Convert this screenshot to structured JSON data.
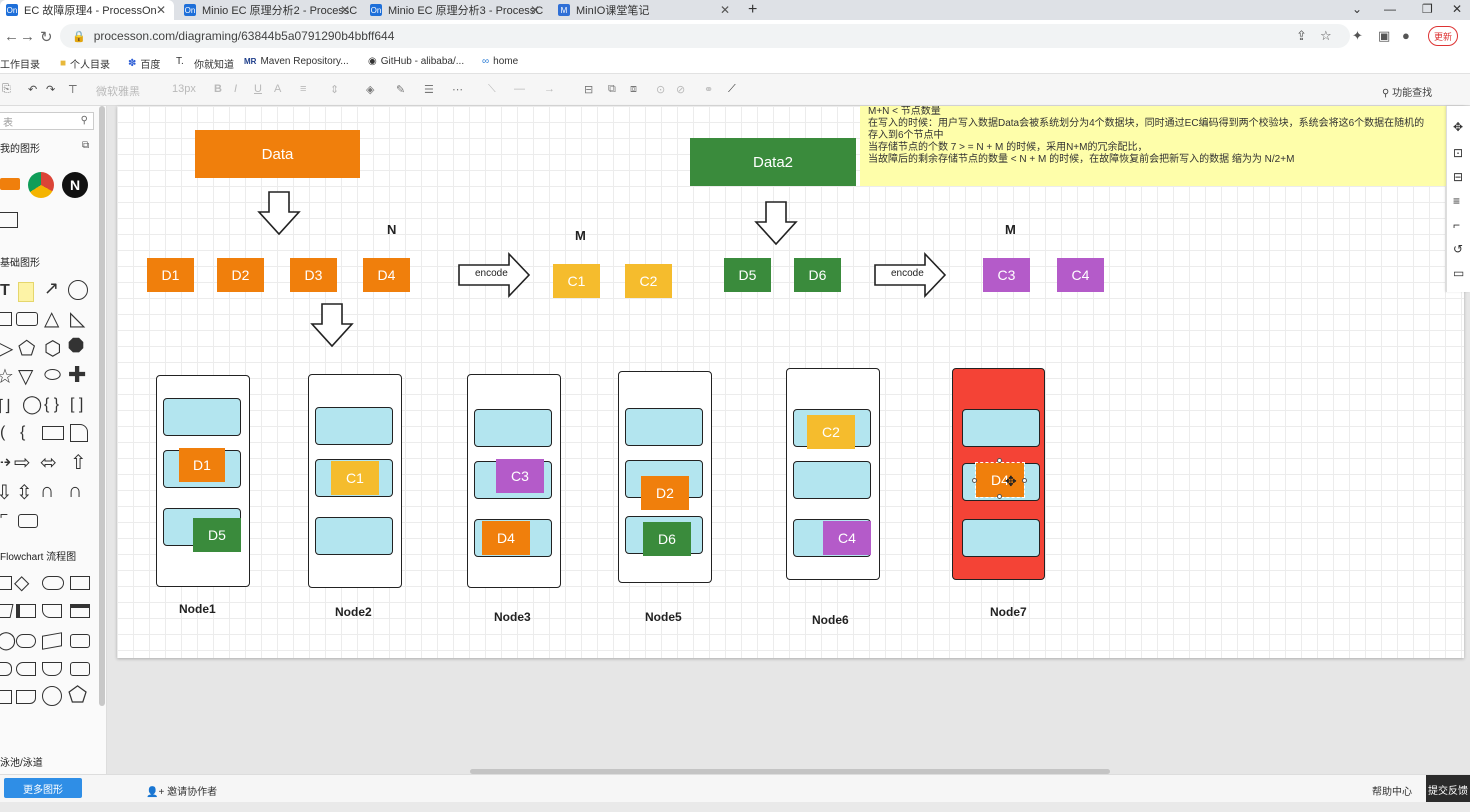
{
  "browser": {
    "tabs": [
      {
        "favicon": "On",
        "title": "EC 故障原理4 - ProcessOn",
        "active": true
      },
      {
        "favicon": "On",
        "title": "Minio EC 原理分析2 - ProcessC",
        "active": false
      },
      {
        "favicon": "On",
        "title": "Minio EC 原理分析3 - ProcessC",
        "active": false
      },
      {
        "favicon": "M",
        "title": "MinIO课堂笔记",
        "active": false
      }
    ],
    "new_tab": "+",
    "address": "processon.com/diagraming/63844b5a0791290b4bbff644",
    "update_label": "更新",
    "bookmarks": [
      {
        "icon": "folder-icon",
        "label": "工作目录"
      },
      {
        "icon": "folder-icon",
        "label": "个人目录"
      },
      {
        "icon": "paw-icon",
        "label": "百度"
      },
      {
        "icon": "",
        "label": "T."
      },
      {
        "icon": "",
        "label": "你就知道"
      },
      {
        "icon": "maven-icon",
        "label": "Maven Repository..."
      },
      {
        "icon": "github-icon",
        "label": "GitHub - alibaba/..."
      },
      {
        "icon": "link-icon",
        "label": "home"
      }
    ]
  },
  "toolbar": {
    "font_family": "微软雅黑",
    "font_size": "13px",
    "shortcuts_label": "功能查找"
  },
  "left_panel": {
    "search_placeholder": "表",
    "sections": [
      "我的图形",
      "基础图形",
      "Flowchart 流程图",
      "泳池/泳道"
    ],
    "more_shapes": "更多图形"
  },
  "statusbar": {
    "invite": "邀请协作者",
    "help": "帮助中心",
    "feedback": "提交反馈"
  },
  "canvas": {
    "data_blocks": [
      {
        "label": "Data",
        "color": "#f07f0c"
      },
      {
        "label": "Data2",
        "color": "#3a8b3c"
      }
    ],
    "letters": {
      "n": "N",
      "m1": "M",
      "m2": "M"
    },
    "encode": [
      "encode",
      "encode"
    ],
    "chunks": [
      "D1",
      "D2",
      "D3",
      "D4",
      "C1",
      "C2",
      "D5",
      "D6",
      "C3",
      "C4"
    ],
    "nodes": [
      {
        "label": "Node1",
        "items": [
          "D1",
          "D5"
        ]
      },
      {
        "label": "Node2",
        "items": [
          "C1"
        ]
      },
      {
        "label": "Node3",
        "items": [
          "C3",
          "D4"
        ]
      },
      {
        "label": "Node5",
        "items": [
          "D2",
          "D6"
        ]
      },
      {
        "label": "Node6",
        "items": [
          "C2",
          "C4"
        ]
      },
      {
        "label": "Node7",
        "items": [
          "D4"
        ],
        "status": "failed",
        "color": "#f44336"
      }
    ],
    "note_lines": [
      "M+N < 节点数量",
      "在写入的时候：用户写入数据Data会被系统划分为4个数据块，同时通过EC编码得到两个校验块，系统会将这6个数据在随机的",
      "存入到6个节点中",
      "当存储节点的个数 7 > = N + M 的时候，采用N+M的冗余配比，",
      "当故障后的剩余存储节点的数量 < N + M 的时候，在故障恢复前会把新写入的数据 缩为为 N/2+M"
    ]
  }
}
